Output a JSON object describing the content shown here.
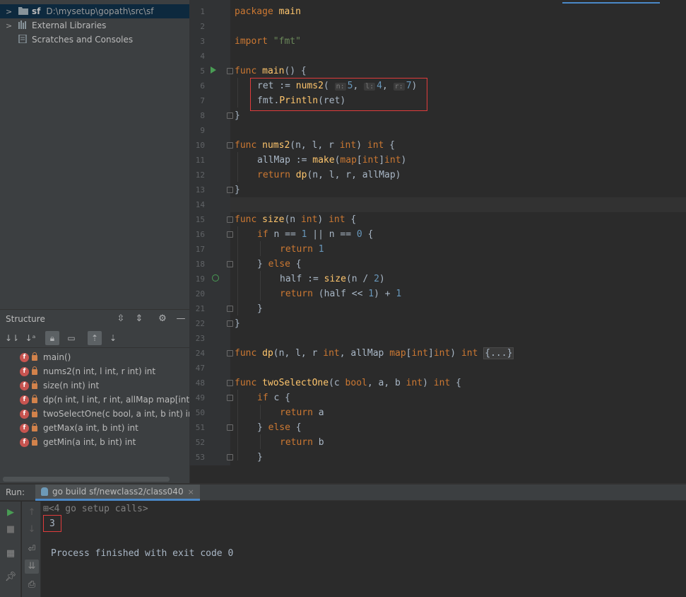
{
  "project_tree": {
    "items": [
      {
        "label": "sf",
        "path": "D:\\mysetup\\gopath\\src\\sf",
        "expander": ">",
        "selected": true
      },
      {
        "label": "External Libraries",
        "expander": ">"
      },
      {
        "label": "Scratches and Consoles"
      }
    ]
  },
  "structure": {
    "title": "Structure",
    "items": [
      {
        "label": "main()"
      },
      {
        "label": "nums2(n int, l int, r int) int"
      },
      {
        "label": "size(n int) int"
      },
      {
        "label": "dp(n int, l int, r int, allMap map[int]int"
      },
      {
        "label": "twoSelectOne(c bool, a int, b int) int"
      },
      {
        "label": "getMax(a int, b int) int"
      },
      {
        "label": "getMin(a int, b int) int"
      }
    ],
    "badge": "f"
  },
  "editor": {
    "line_numbers": [
      "1",
      "2",
      "3",
      "4",
      "5",
      "6",
      "7",
      "8",
      "9",
      "10",
      "11",
      "12",
      "13",
      "14",
      "15",
      "16",
      "17",
      "18",
      "19",
      "20",
      "21",
      "22",
      "23",
      "24",
      "47",
      "48",
      "49",
      "50",
      "51",
      "52",
      "53"
    ],
    "tokens": {
      "package": "package",
      "main_pkg": "main",
      "import": "import",
      "fmt_str": "\"fmt\"",
      "func": "func",
      "main_fn": "main",
      "main_sig": "() {",
      "ret_assign": "ret := ",
      "nums2": "nums2",
      "paren_open": "(",
      "hint_n": "n:",
      "hint_l": "l:",
      "hint_r": "r:",
      "v5": "5",
      "v4": "4",
      "v7": "7",
      "comma": ", ",
      "paren_close": ")",
      "fmt_pkg": "fmt.",
      "println": "Println",
      "println_args": "(ret)",
      "close_brace": "}",
      "nums2_params": "(n, l, r ",
      "int": "int",
      "nums2_ret": ") int {",
      "allmap_assign": "allMap := ",
      "make": "make",
      "map_kw": "map",
      "map_type_open": "(",
      "map_key": "[int]",
      "map_close": "int)",
      "return": "return",
      "dp_call": "dp",
      "dp_args": "(n, l, r, allMap)",
      "size_fn": "size",
      "size_params": "(n ",
      "size_ret_a": ") ",
      "open_brace": " {",
      "if": "if",
      "cond1": " n == ",
      "v1": "1",
      "or": " || n == ",
      "v0": "0",
      "else": "else",
      "half_assign": "half := ",
      "size_call": "size",
      "size_arg": "(n / ",
      "v2": "2",
      "size_close": ")",
      "half_shift": " (half << ",
      "plus": ") + ",
      "dp_fn": "dp",
      "dp_params_a": "(n, l, r ",
      "dp_params_b": ", allMap ",
      "dp_map": "map",
      "dp_map_b": "[int]",
      "dp_map_c": "int",
      "dp_ret": ") ",
      "folded": "{...}",
      "two_fn": "twoSelectOne",
      "two_params_a": "(c ",
      "bool": "bool",
      "two_params_b": ", a, b ",
      "two_ret": ") ",
      "if_c": " c {",
      "ret_a": " a",
      "ret_b": " b",
      "else_open": "} ",
      "space": " "
    }
  },
  "run_panel": {
    "label": "Run:",
    "tab_label": "go build sf/newclass2/class040",
    "tab_close": "×",
    "setup_calls": "<4 go setup calls>",
    "output_value": "3",
    "exit_message": "Process finished with exit code 0"
  }
}
